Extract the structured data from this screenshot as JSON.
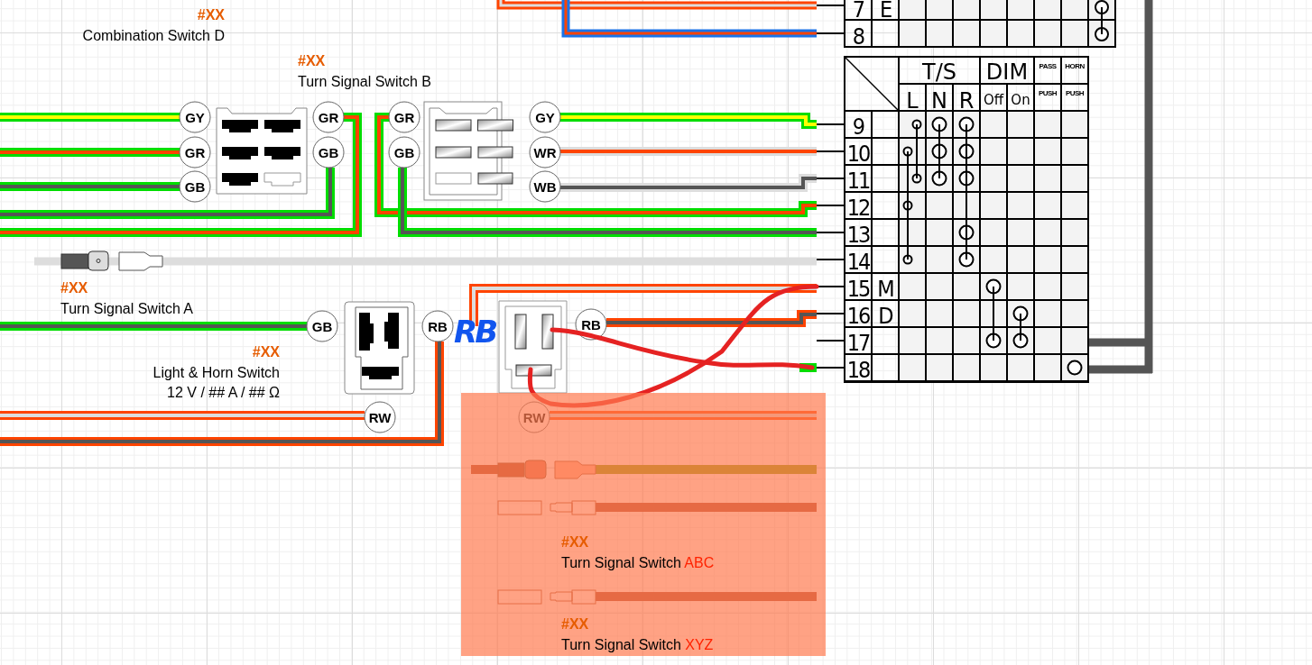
{
  "components": [
    {
      "code": "#XX",
      "name": "Combination Switch D"
    },
    {
      "code": "#XX",
      "name": "Turn Signal Switch B"
    },
    {
      "code": "#XX",
      "name": "Turn Signal Switch A"
    },
    {
      "code": "#XX",
      "name": "Light & Horn Switch",
      "rating": "12 V / ## A / ## Ω"
    },
    {
      "code": "#XX",
      "name": "Turn Signal Switch",
      "suffix": "ABC"
    },
    {
      "code": "#XX",
      "name": "Turn Signal Switch",
      "suffix": "XYZ"
    }
  ],
  "pin_labels": [
    "GY",
    "GR",
    "GB",
    "GR",
    "GB",
    "GR",
    "GB",
    "GY",
    "WR",
    "WB",
    "GB",
    "RB",
    "RW",
    "RB",
    "RW"
  ],
  "handwritten_note": "RB",
  "switch_table": {
    "top_rows": [
      {
        "label": "7",
        "letter": "E",
        "dots": [
          false,
          false,
          false,
          false,
          false,
          false,
          false,
          true
        ]
      },
      {
        "label": "8",
        "dots": [
          false,
          false,
          false,
          false,
          false,
          false,
          false,
          true
        ]
      }
    ],
    "groups": [
      {
        "label": "T/S"
      },
      {
        "label": "DIM"
      },
      {
        "label": "PASS"
      },
      {
        "label": "HORN"
      }
    ],
    "columns": [
      "L",
      "N",
      "R",
      "Off",
      "On",
      "PUSH",
      "PUSH"
    ],
    "rows": [
      {
        "label": "9",
        "dots": [
          true,
          true,
          true,
          false,
          false,
          false,
          false
        ]
      },
      {
        "label": "10",
        "dots": [
          true,
          true,
          true,
          false,
          false,
          false,
          false
        ]
      },
      {
        "label": "11",
        "dots": [
          true,
          true,
          true,
          false,
          false,
          false,
          false
        ]
      },
      {
        "label": "12",
        "dots": [
          true,
          false,
          false,
          false,
          false,
          false,
          false
        ]
      },
      {
        "label": "13",
        "dots": [
          false,
          false,
          true,
          false,
          false,
          false,
          false
        ]
      },
      {
        "label": "14",
        "dots": [
          true,
          false,
          true,
          false,
          false,
          false,
          false
        ]
      },
      {
        "label": "15",
        "letter": "M",
        "dots": [
          false,
          false,
          false,
          true,
          false,
          false,
          false
        ]
      },
      {
        "label": "16",
        "letter": "D",
        "dots": [
          false,
          false,
          false,
          false,
          true,
          false,
          false
        ]
      },
      {
        "label": "17",
        "dots": [
          false,
          false,
          false,
          true,
          true,
          false,
          false
        ]
      },
      {
        "label": "18",
        "dots": [
          false,
          false,
          false,
          false,
          false,
          false,
          true
        ]
      }
    ]
  }
}
